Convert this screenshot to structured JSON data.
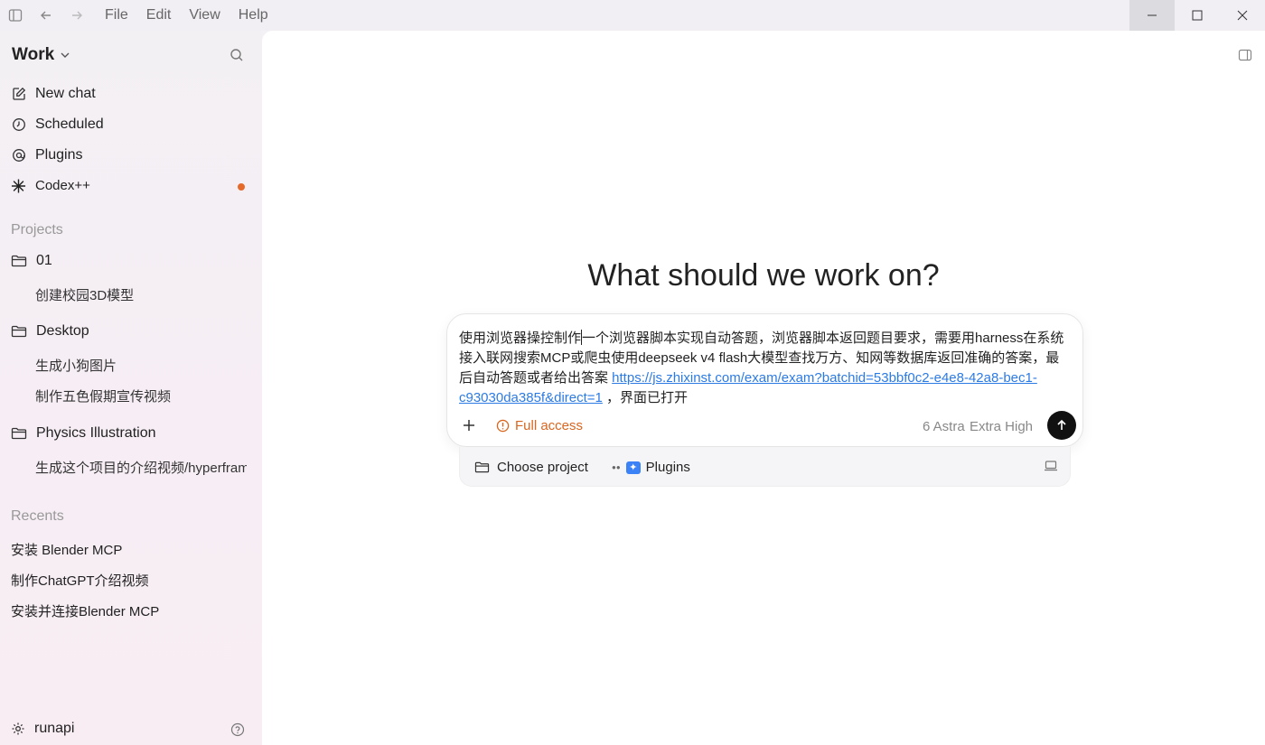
{
  "menu": {
    "file": "File",
    "edit": "Edit",
    "view": "View",
    "help": "Help"
  },
  "sidebar": {
    "workspace": "Work",
    "nav": {
      "new_chat": "New chat",
      "scheduled": "Scheduled",
      "plugins": "Plugins",
      "codex": "Codex++"
    },
    "projects_label": "Projects",
    "projects": [
      {
        "name": "01",
        "chats": [
          "创建校园3D模型"
        ]
      },
      {
        "name": "Desktop",
        "chats": [
          "生成小狗图片",
          "制作五色假期宣传视频"
        ]
      },
      {
        "name": "Physics Illustration",
        "chats": [
          "生成这个项目的介绍视频/hyperframes"
        ]
      }
    ],
    "recents_label": "Recents",
    "recents": [
      "安装 Blender MCP",
      "制作ChatGPT介绍视频",
      "安装并连接Blender MCP"
    ],
    "user": "runapi"
  },
  "main": {
    "headline": "What should we work on?",
    "prompt": {
      "text_before_caret": "使用浏览器操控制作",
      "text_after_caret": "一个浏览器脚本实现自动答题，浏览器脚本返回题目要求，需要用harness在系统接入联网搜索MCP或爬虫使用deepseek v4 flash大模型查找万方、知网等数据库返回准确的答案，最后自动答题或者给出答案 ",
      "link": "https://js.zhixinst.com/exam/exam?batchid=53bbf0c2-e4e8-42a8-bec1-c93030da385f&direct=1",
      "text_end": " ，界面已打开"
    },
    "access_label": "Full access",
    "model_label": "6 Astra",
    "effort_label": "Extra High",
    "choose_project": "Choose project",
    "plugins_label": "Plugins",
    "accent_color": "#d9661f"
  }
}
